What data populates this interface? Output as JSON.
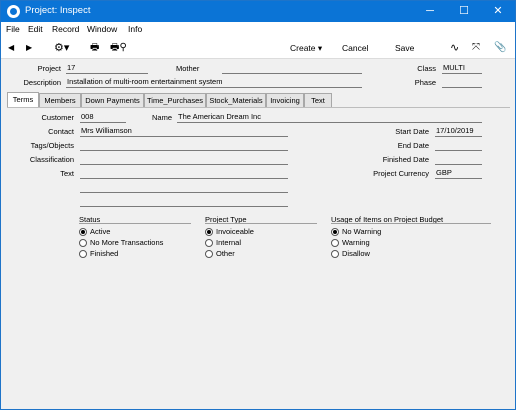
{
  "window": {
    "title": "Project: Inspect",
    "minimize_glyph": "─",
    "maximize_glyph": "☐",
    "close_glyph": "✕"
  },
  "menu": [
    "File",
    "Edit",
    "Record",
    "Window",
    "Info"
  ],
  "toolbar": {
    "prev_glyph": "◀",
    "next_glyph": "▶",
    "settings_glyph": "⚙▾",
    "print_glyph": "🖶",
    "preview_glyph": "🖶⚲",
    "create_label": "Create ▾",
    "cancel_label": "Cancel",
    "save_label": "Save",
    "activity_glyph": "∿",
    "expand_glyph": "⤧",
    "attach_glyph": "📎"
  },
  "header": {
    "project_label": "Project",
    "project_value": "17",
    "mother_label": "Mother",
    "mother_value": "",
    "class_label": "Class",
    "class_value": "MULTI",
    "description_label": "Description",
    "description_value": "Installation of multi-room entertainment system",
    "phase_label": "Phase",
    "phase_value": ""
  },
  "tabs": [
    "Terms",
    "Members",
    "Down Payments",
    "Time_Purchases",
    "Stock_Materials",
    "Invoicing",
    "Text"
  ],
  "terms": {
    "customer_label": "Customer",
    "customer_value": "008",
    "name_label": "Name",
    "name_value": "The American Dream Inc",
    "contact_label": "Contact",
    "contact_value": "Mrs Williamson",
    "tags_label": "Tags/Objects",
    "tags_value": "",
    "classification_label": "Classification",
    "classification_value": "",
    "text_label": "Text",
    "text_value": "",
    "start_date_label": "Start Date",
    "start_date_value": "17/10/2019",
    "end_date_label": "End Date",
    "end_date_value": "",
    "finished_date_label": "Finished Date",
    "finished_date_value": "",
    "currency_label": "Project Currency",
    "currency_value": "GBP"
  },
  "status": {
    "title": "Status",
    "options": [
      "Active",
      "No More Transactions",
      "Finished"
    ],
    "selected": "Active"
  },
  "project_type": {
    "title": "Project Type",
    "options": [
      "Invoiceable",
      "Internal",
      "Other"
    ],
    "selected": "Invoiceable"
  },
  "usage": {
    "title": "Usage of Items on Project Budget",
    "options": [
      "No Warning",
      "Warning",
      "Disallow"
    ],
    "selected": "No Warning"
  }
}
